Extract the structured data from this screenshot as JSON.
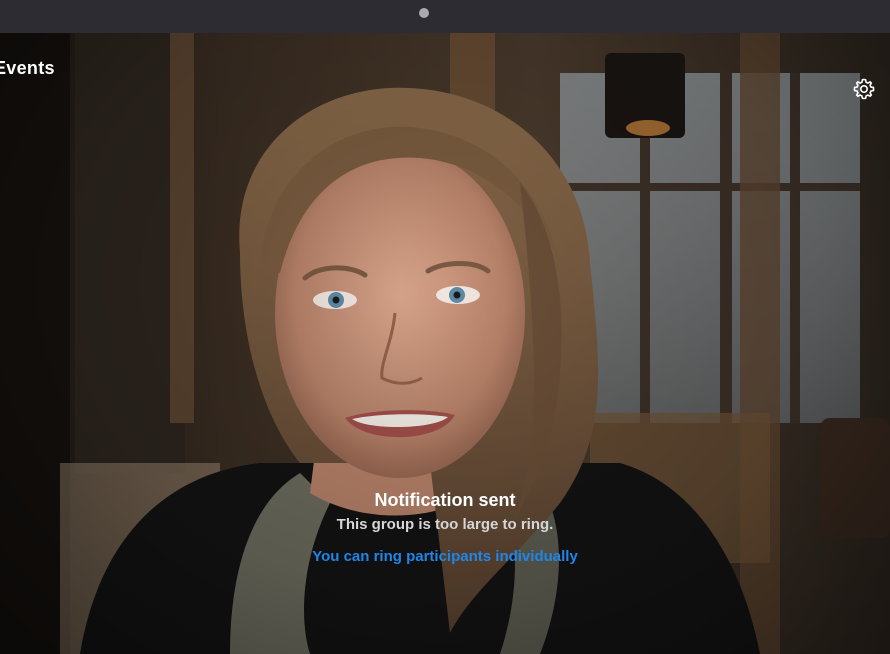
{
  "window": {
    "title": "Events"
  },
  "header": {
    "settings_icon": "gear-icon"
  },
  "notification": {
    "title": "Notification sent",
    "message": "This group is too large to ring.",
    "action_link": "You can ring participants individually"
  },
  "colors": {
    "link": "#1f86e8",
    "top_bar": "#2c2c32",
    "text_primary": "#ffffff"
  }
}
